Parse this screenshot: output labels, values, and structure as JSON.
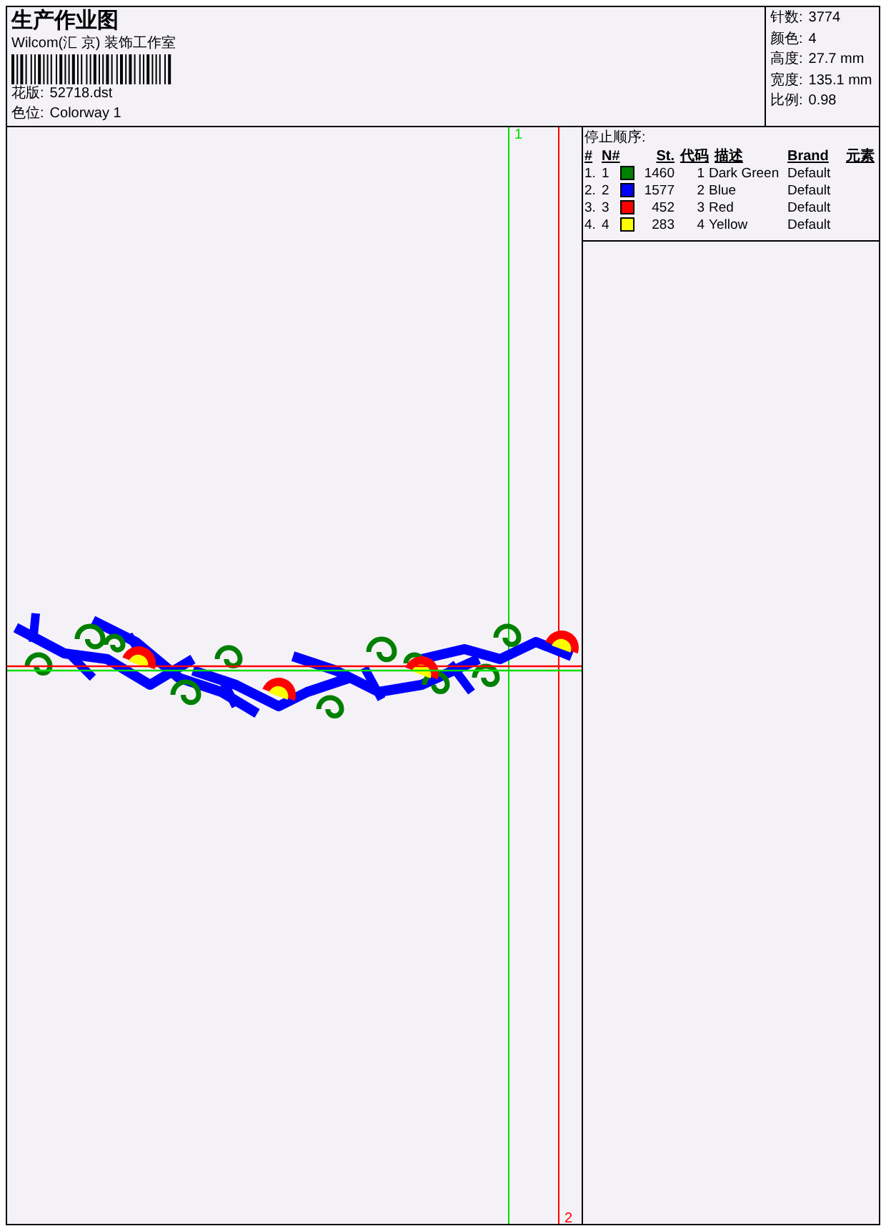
{
  "title": "生产作业图",
  "company": "Wilcom(汇 京) 装饰工作室",
  "design_file": {
    "label": "花版:",
    "value": "52718.dst"
  },
  "colorway": {
    "label": "色位:",
    "value": "Colorway 1"
  },
  "stats": [
    {
      "label": "针数:",
      "value": "3774"
    },
    {
      "label": "颜色:",
      "value": "4"
    },
    {
      "label": "高度:",
      "value": "27.7 mm"
    },
    {
      "label": "宽度:",
      "value": "135.1 mm"
    },
    {
      "label": "比例:",
      "value": "0.98"
    }
  ],
  "stop_sequence": {
    "title": "停止顺序:",
    "columns": [
      "#",
      "N#",
      "St.",
      "代码",
      "描述",
      "Brand",
      "元素"
    ],
    "rows": [
      {
        "index": "1.",
        "stop": "1",
        "color": "#008000",
        "stitches": "1460",
        "code": "1",
        "description": "Dark Green",
        "brand": "Default"
      },
      {
        "index": "2.",
        "stop": "2",
        "color": "#0000ff",
        "stitches": "1577",
        "code": "2",
        "description": "Blue",
        "brand": "Default"
      },
      {
        "index": "3.",
        "stop": "3",
        "color": "#ff0000",
        "stitches": "452",
        "code": "3",
        "description": "Red",
        "brand": "Default"
      },
      {
        "index": "4.",
        "stop": "4",
        "color": "#ffff00",
        "stitches": "283",
        "code": "4",
        "description": "Yellow",
        "brand": "Default"
      }
    ]
  },
  "markers": [
    {
      "label": "1",
      "color": "#00dd00"
    },
    {
      "label": "2",
      "color": "#ff0000"
    }
  ]
}
